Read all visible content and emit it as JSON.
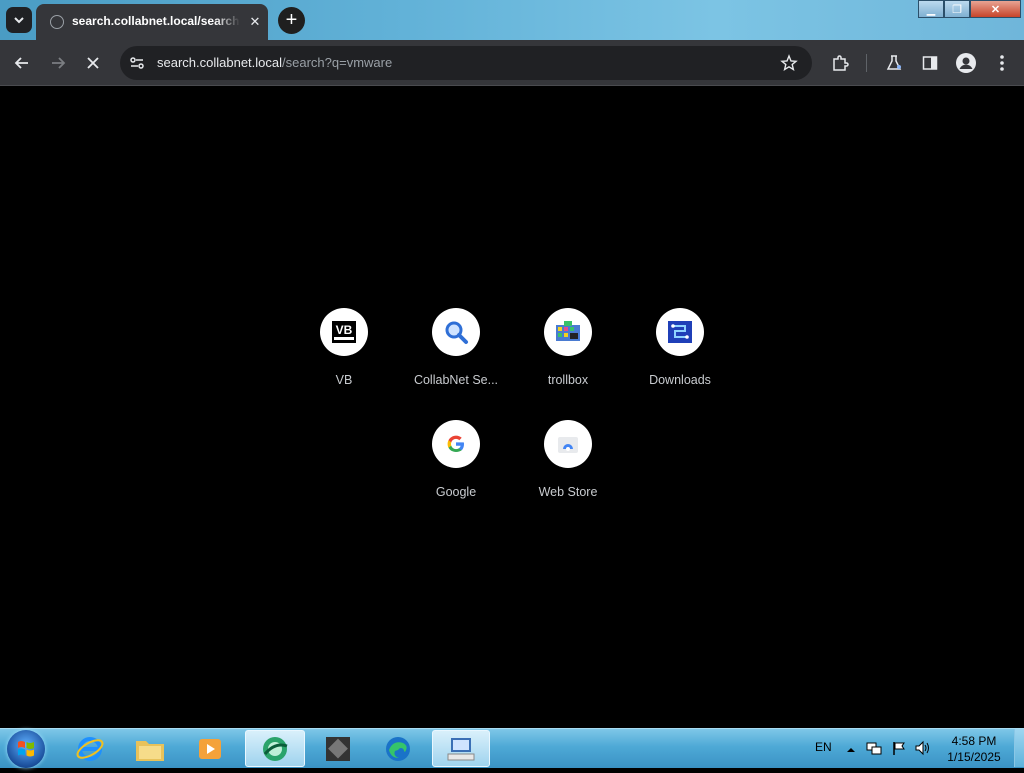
{
  "browser": {
    "tab": {
      "title": "search.collabnet.local/search?q=vmware",
      "close_glyph": "✕"
    },
    "new_tab_glyph": "+",
    "address": {
      "host": "search.collabnet.local",
      "path": "/search?q=vmware"
    },
    "window_buttons": {
      "minimize": "▁",
      "maximize": "❐",
      "close": "✕"
    }
  },
  "shortcuts": [
    {
      "label": "VB",
      "icon": "vb-icon"
    },
    {
      "label": "CollabNet Se...",
      "icon": "search-magnifier-icon"
    },
    {
      "label": "trollbox",
      "icon": "trollbox-icon"
    },
    {
      "label": "Downloads",
      "icon": "downloads-icon"
    },
    {
      "label": "Google",
      "icon": "google-icon"
    },
    {
      "label": "Web Store",
      "icon": "web-store-icon"
    }
  ],
  "taskbar": {
    "language": "EN",
    "time": "4:58 PM",
    "date": "1/15/2025"
  }
}
